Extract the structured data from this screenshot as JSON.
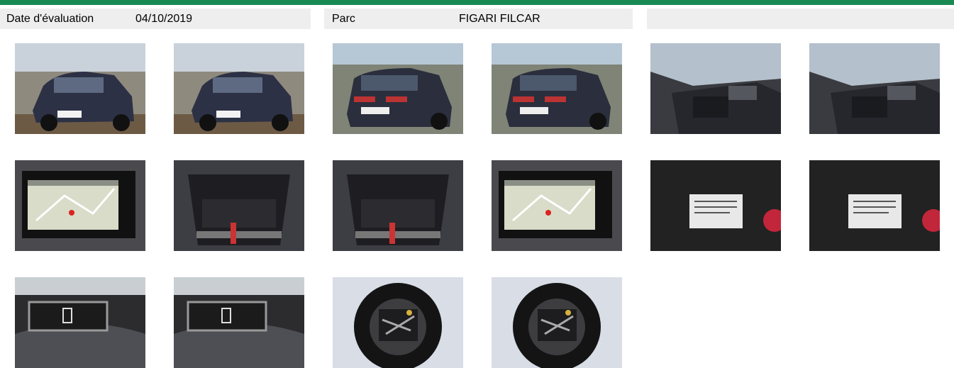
{
  "header": {
    "date_label": "Date d'évaluation",
    "date_value": "04/10/2019",
    "park_label": "Parc",
    "park_value": "FIGARI FILCAR",
    "third_block": ""
  },
  "colors": {
    "accent": "#1a8a55",
    "info_bg": "#eeeeee"
  },
  "photos": [
    {
      "name": "car-front-left-photo",
      "kind": "car-front"
    },
    {
      "name": "car-front-right-photo",
      "kind": "car-front"
    },
    {
      "name": "car-rear-left-photo",
      "kind": "car-rear"
    },
    {
      "name": "car-rear-right-photo",
      "kind": "car-rear"
    },
    {
      "name": "interior-dashboard-photo",
      "kind": "interior"
    },
    {
      "name": "interior-seats-photo",
      "kind": "interior"
    },
    {
      "name": "navigation-screen-photo",
      "kind": "screen"
    },
    {
      "name": "open-trunk-photo",
      "kind": "trunk"
    },
    {
      "name": "trunk-cargo-photo",
      "kind": "trunk"
    },
    {
      "name": "navigation-screen-2-photo",
      "kind": "screen"
    },
    {
      "name": "vin-label-photo",
      "kind": "label"
    },
    {
      "name": "vin-label-2-photo",
      "kind": "label"
    },
    {
      "name": "odometer-photo",
      "kind": "odometer"
    },
    {
      "name": "instrument-cluster-photo",
      "kind": "odometer"
    },
    {
      "name": "spare-wheel-photo",
      "kind": "wheel"
    },
    {
      "name": "spare-wheel-2-photo",
      "kind": "wheel"
    }
  ]
}
